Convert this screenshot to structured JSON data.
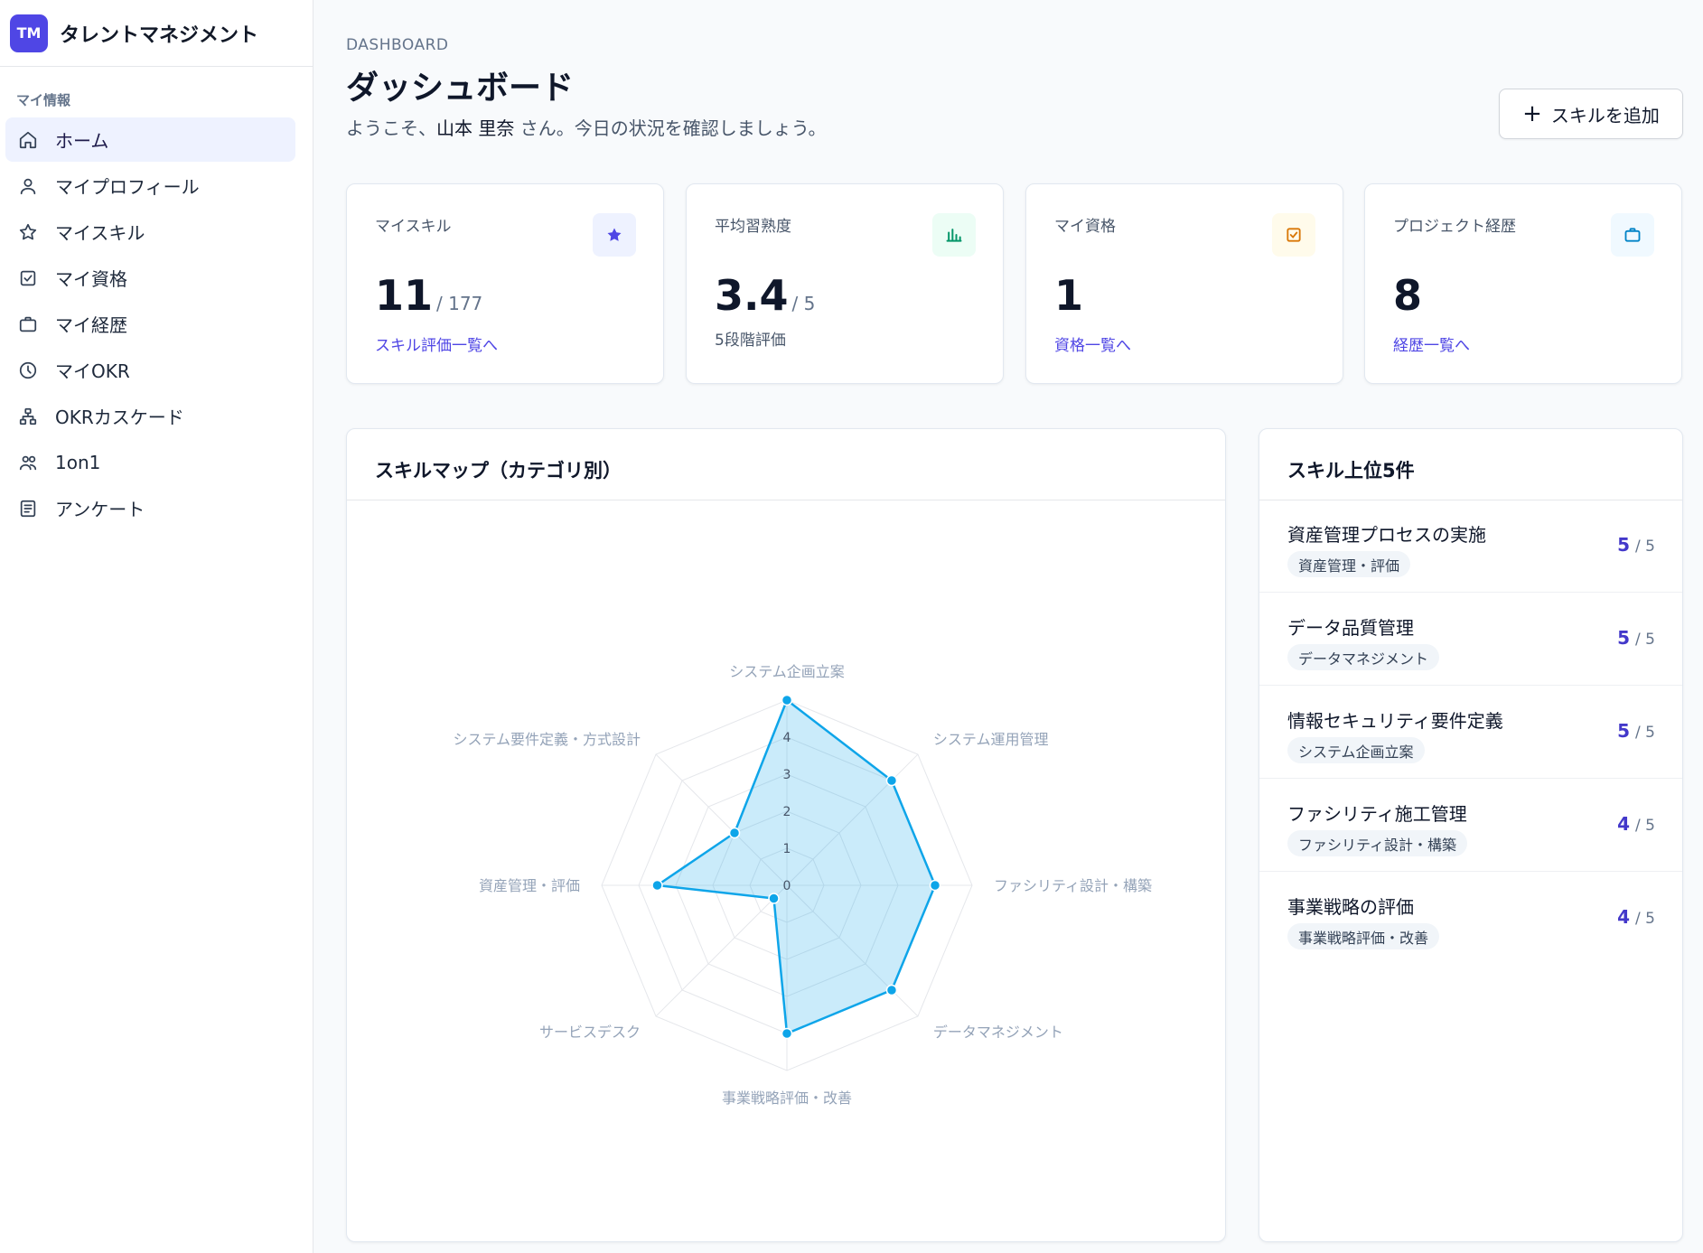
{
  "brand": {
    "logo": "TM",
    "name": "タレントマネジメント"
  },
  "sidebar": {
    "section_label": "マイ情報",
    "items": [
      {
        "label": "ホーム",
        "icon": "home-icon",
        "active": true
      },
      {
        "label": "マイプロフィール",
        "icon": "user-icon"
      },
      {
        "label": "マイスキル",
        "icon": "star-icon"
      },
      {
        "label": "マイ資格",
        "icon": "checkbox-icon"
      },
      {
        "label": "マイ経歴",
        "icon": "briefcase-icon"
      },
      {
        "label": "マイOKR",
        "icon": "clock-icon"
      },
      {
        "label": "OKRカスケード",
        "icon": "hierarchy-icon"
      },
      {
        "label": "1on1",
        "icon": "users-icon"
      },
      {
        "label": "アンケート",
        "icon": "form-icon"
      }
    ]
  },
  "header": {
    "crumb": "DASHBOARD",
    "title": "ダッシュボード",
    "welcome_prefix": "ようこそ、",
    "user_name": "山本 里奈",
    "welcome_suffix": " さん。今日の状況を確認しましょう。",
    "add_button": "スキルを追加"
  },
  "stats": [
    {
      "label": "マイスキル",
      "value": "11",
      "unit": "/ 177",
      "link": "スキル評価一覧へ",
      "icon": "star-icon",
      "color": "#4f46e5",
      "bg": "#eef2ff"
    },
    {
      "label": "平均習熟度",
      "value": "3.4",
      "unit": "/ 5",
      "sub": "5段階評価",
      "icon": "bar-chart-icon",
      "color": "#059669",
      "bg": "#ecfdf5"
    },
    {
      "label": "マイ資格",
      "value": "1",
      "unit": "",
      "link": "資格一覧へ",
      "icon": "check-square-icon",
      "color": "#d97706",
      "bg": "#fffbeb"
    },
    {
      "label": "プロジェクト経歴",
      "value": "8",
      "unit": "",
      "link": "経歴一覧へ",
      "icon": "briefcase-icon",
      "color": "#0284c7",
      "bg": "#f0f9ff"
    }
  ],
  "skillmap": {
    "title": "スキルマップ（カテゴリ別）",
    "chart_data": {
      "type": "radar",
      "categories": [
        "システム企画立案",
        "システム運用管理",
        "ファシリティ設計・構築",
        "データマネジメント",
        "事業戦略評価・改善",
        "サービスデスク",
        "資産管理・評価",
        "システム要件定義・方式設計"
      ],
      "values": [
        5,
        4,
        4,
        4,
        4,
        0.5,
        3.5,
        2
      ],
      "ylim": [
        0,
        5
      ],
      "ticks": [
        "0",
        "1",
        "2",
        "3",
        "4",
        "5"
      ],
      "color": "#0ea5e9"
    }
  },
  "top_skills": {
    "title": "スキル上位5件",
    "max_label": "/ 5",
    "items": [
      {
        "name": "資産管理プロセスの実施",
        "category": "資産管理・評価",
        "score": "5"
      },
      {
        "name": "データ品質管理",
        "category": "データマネジメント",
        "score": "5"
      },
      {
        "name": "情報セキュリティ要件定義",
        "category": "システム企画立案",
        "score": "5"
      },
      {
        "name": "ファシリティ施工管理",
        "category": "ファシリティ設計・構築",
        "score": "4"
      },
      {
        "name": "事業戦略の評価",
        "category": "事業戦略評価・改善",
        "score": "4"
      }
    ]
  }
}
